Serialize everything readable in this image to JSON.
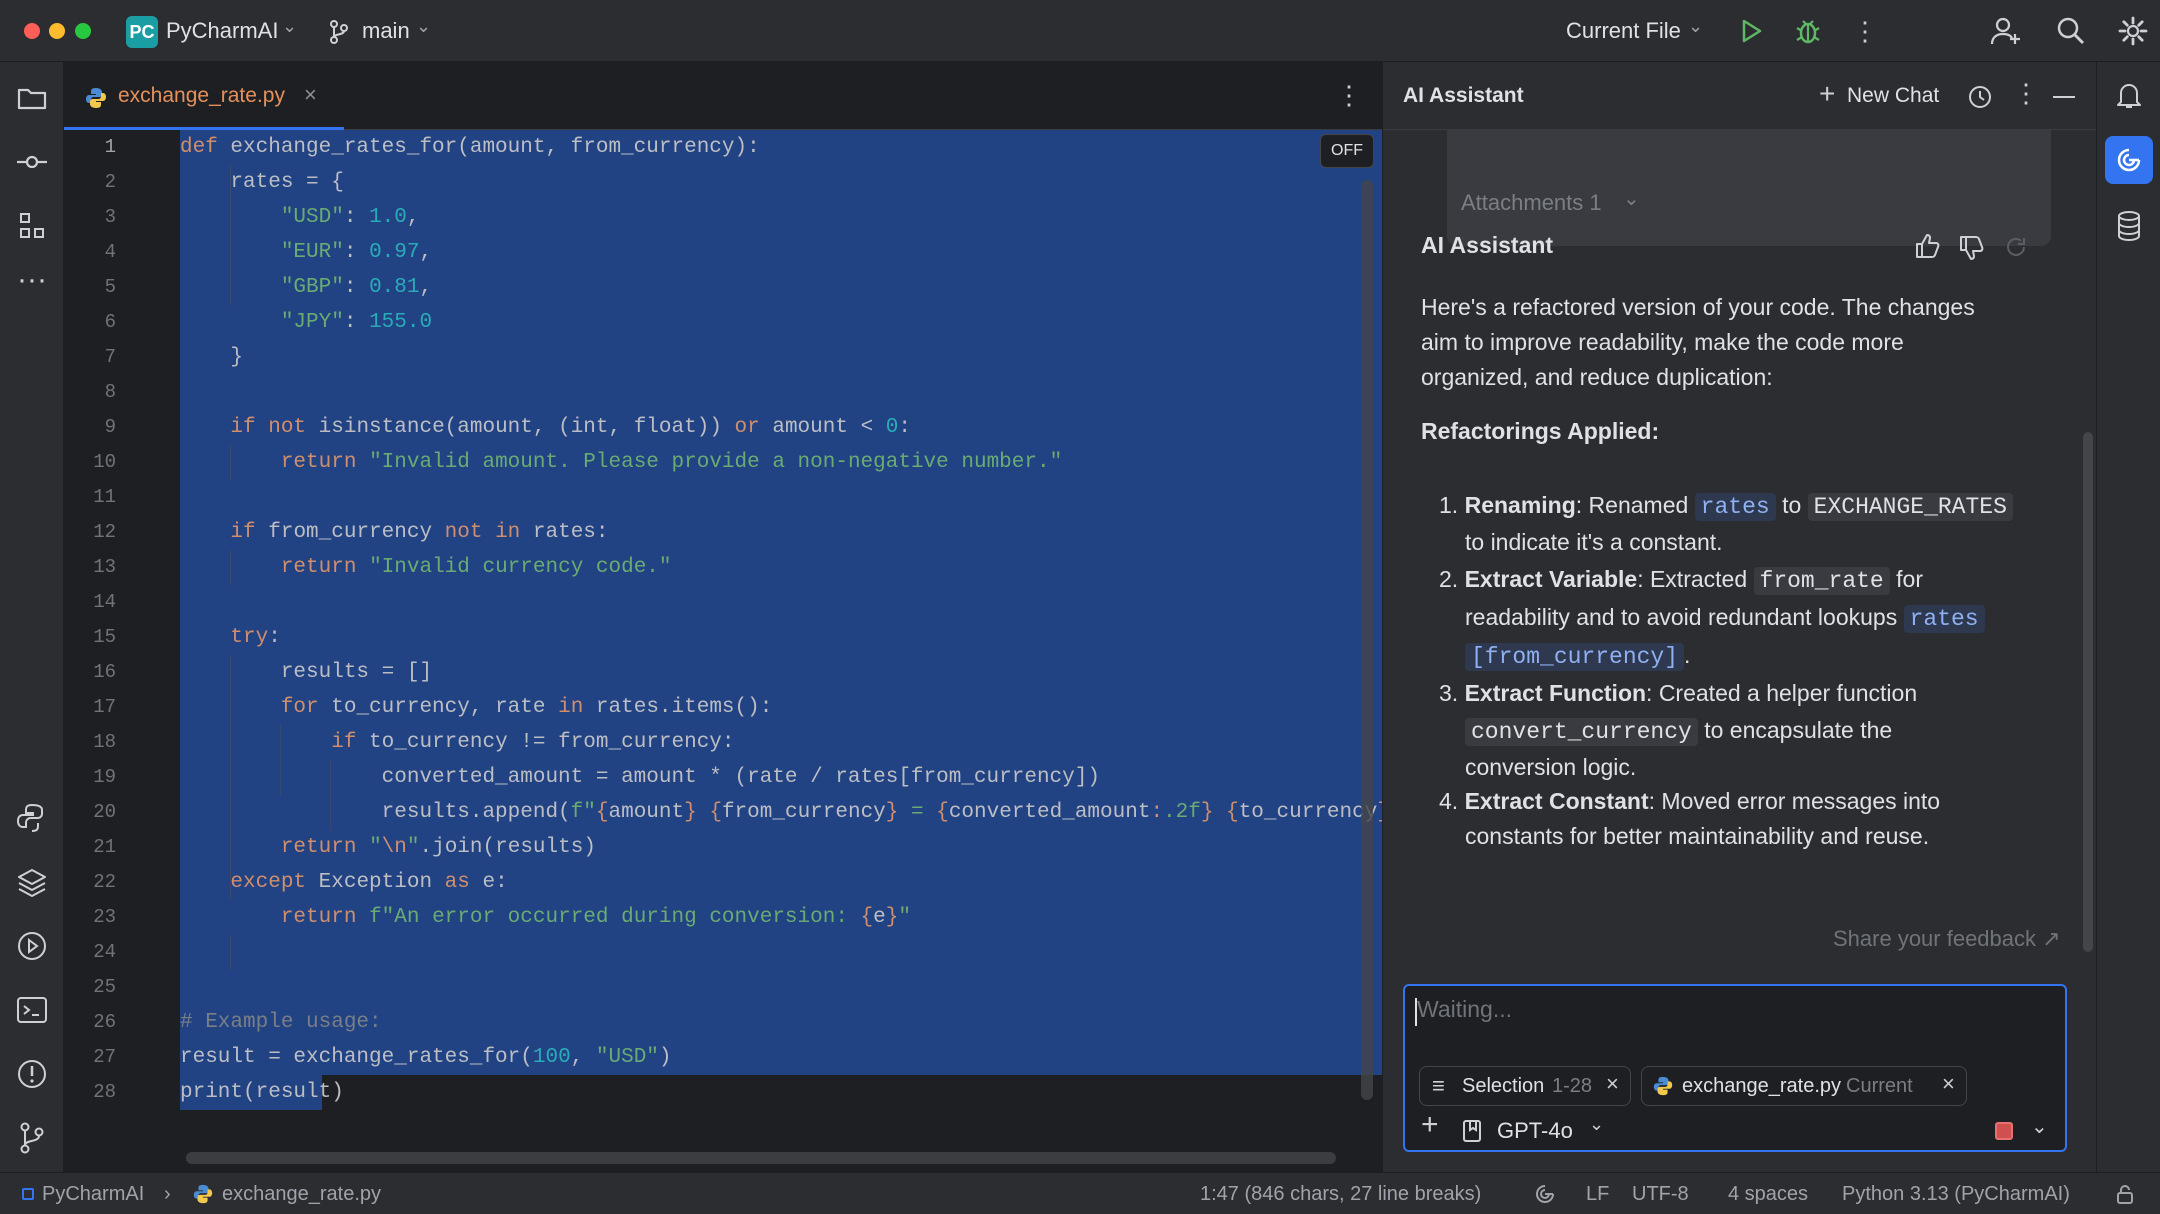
{
  "titlebar": {
    "project_badge": "PC",
    "project_name": "PyCharmAI",
    "branch": "main",
    "run_config": "Current File"
  },
  "editor": {
    "tab_label": "exchange_rate.py",
    "off_badge": "OFF",
    "line_numbers": [
      "1",
      "2",
      "3",
      "4",
      "5",
      "6",
      "7",
      "8",
      "9",
      "10",
      "11",
      "12",
      "13",
      "14",
      "15",
      "16",
      "17",
      "18",
      "19",
      "20",
      "21",
      "22",
      "23",
      "24",
      "25",
      "26",
      "27",
      "28"
    ]
  },
  "ai": {
    "header_title": "AI Assistant",
    "new_chat_label": "New Chat",
    "attachments_label": "Attachments 1",
    "response_author": "AI Assistant",
    "intro_lines": [
      "Here's a refactored version of your code. The changes",
      "aim to improve readability, make the code more",
      "organized, and reduce duplication:"
    ],
    "section_title": "Refactorings Applied:",
    "items": [
      {
        "num": "1.",
        "title": "Renaming",
        "sep": ": Renamed ",
        "c1": "rates",
        "mid": " to ",
        "c2": "EXCHANGE_RATES",
        "line2": "to indicate it's a constant."
      },
      {
        "num": "2.",
        "title": "Extract Variable",
        "sep": ": Extracted ",
        "c1": "from_rate",
        "mid": " for",
        "line2": "readability and to avoid redundant lookups ",
        "c2": "rates",
        "line3chip": "[from_currency]",
        "line3tail": "."
      },
      {
        "num": "3.",
        "title": "Extract Function",
        "sep": ": Created a helper function",
        "c1": "convert_currency",
        "mid": " to encapsulate the",
        "line3": "conversion logic."
      },
      {
        "num": "4.",
        "title": "Extract Constant",
        "sep": ": Moved error messages into",
        "line2": "constants for better maintainability and reuse."
      }
    ],
    "feedback_link": "Share your feedback ↗",
    "input_placeholder": "Waiting...",
    "chip_selection": "Selection",
    "chip_selection_range": "1-28",
    "chip_file": "exchange_rate.py",
    "chip_file_tag": "Current",
    "model": "GPT-4o"
  },
  "statusbar": {
    "crumb_project": "PyCharmAI",
    "crumb_file": "exchange_rate.py",
    "position": "1:47 (846 chars, 27 line breaks)",
    "line_sep": "LF",
    "encoding": "UTF-8",
    "indent": "4 spaces",
    "interpreter": "Python 3.13 (PyCharmAI)"
  },
  "colors": {
    "selection": "#214283",
    "accent": "#3574f0",
    "run_green": "#5fb865",
    "mac_red": "#ff5f57",
    "mac_yellow": "#febc2e",
    "mac_green": "#28c840"
  }
}
